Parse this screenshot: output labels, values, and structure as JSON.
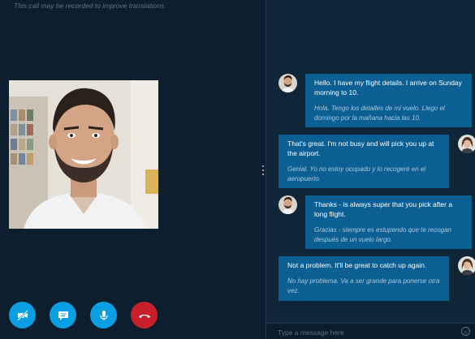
{
  "call": {
    "notice": "This call may be recorded to improve translations.",
    "controls": [
      {
        "name": "camera-off",
        "icon": "video-off-icon",
        "color": "#0a9ee3"
      },
      {
        "name": "chat",
        "icon": "chat-bubble-icon",
        "color": "#0a9ee3"
      },
      {
        "name": "microphone",
        "icon": "microphone-icon",
        "color": "#0a9ee3"
      },
      {
        "name": "hang-up",
        "icon": "phone-hangup-icon",
        "color": "#c8202a"
      }
    ]
  },
  "chat": {
    "messages": [
      {
        "sender": "remote",
        "original": "Hello. I have my flight details. I arrive on Sunday morning to 10.",
        "translation": "Hola. Tengo los detalles de mi vuelo. Llego el domingo por la mañana hacia las 10."
      },
      {
        "sender": "self",
        "original": "That's great. I'm not busy and will pick you up at the airport.",
        "translation": "Genial. Yo no estoy ocupado y lo recogeré en el aeropuerto."
      },
      {
        "sender": "remote",
        "original": "Thanks - is always super that you pick after a long flight.",
        "translation": "Gracias - siempre es estupendo que te recogan después de un vuelo largo."
      },
      {
        "sender": "self",
        "original": "Not a problem. It'll be great to catch up again.",
        "translation": "No hay problema. Va a ser grande para ponerse otra vez."
      }
    ],
    "composer": {
      "placeholder": "Type a message here"
    }
  },
  "colors": {
    "accent": "#0a9ee3",
    "bubble": "#0c5f93",
    "hangup": "#c8202a",
    "background": "#0d1f2e"
  }
}
